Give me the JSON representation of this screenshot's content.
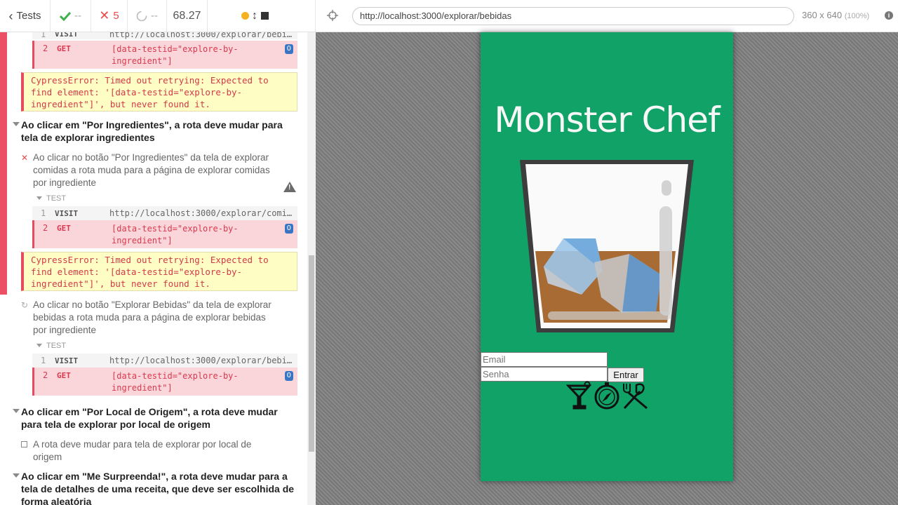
{
  "reporter": {
    "stats": {
      "tests_label": "Tests",
      "passed": "--",
      "failed": "5",
      "pending": "--",
      "duration": "68.27"
    },
    "commands_top": [
      {
        "num": "1",
        "name": "VISIT",
        "msg": "http://localhost:3000/explorar/bebi..."
      },
      {
        "num": "2",
        "name": "GET",
        "msg": "[data-testid=\"explore-by-ingredient\"]",
        "badge": "0"
      }
    ],
    "error_1": "CypressError: Timed out retrying: Expected to find element: '[data-testid=\"explore-by-ingredient\"]', but never found it.",
    "suite_1": "Ao clicar em \"Por Ingredientes\", a rota deve mudar para tela de explorar ingredientes",
    "test_1": "Ao clicar no botão \"Por Ingredientes\" da tela de explorar comidas a rota muda para a página de explorar comidas por ingrediente",
    "test_label": "TEST",
    "commands_1": [
      {
        "num": "1",
        "name": "VISIT",
        "msg": "http://localhost:3000/explorar/comi..."
      },
      {
        "num": "2",
        "name": "GET",
        "msg": "[data-testid=\"explore-by-ingredient\"]",
        "badge": "0"
      }
    ],
    "error_2": "CypressError: Timed out retrying: Expected to find element: '[data-testid=\"explore-by-ingredient\"]', but never found it.",
    "test_2": "Ao clicar no botão \"Explorar Bebidas\" da tela de explorar bebidas a rota muda para a página de explorar bebidas por ingrediente",
    "commands_2": [
      {
        "num": "1",
        "name": "VISIT",
        "msg": "http://localhost:3000/explorar/bebi..."
      },
      {
        "num": "2",
        "name": "GET",
        "msg": "[data-testid=\"explore-by-ingredient\"]",
        "badge": "0"
      }
    ],
    "suite_2": "Ao clicar em \"Por Local de Origem\", a rota deve mudar para tela de explorar por local de origem",
    "test_3": "A rota deve mudar para tela de explorar por local de origem",
    "suite_3": "Ao clicar em \"Me Surpreenda!\", a rota deve mudar para a tela de detalhes de uma receita, que deve ser escolhida de forma aleatória"
  },
  "browser": {
    "url": "http://localhost:3000/explorar/bebidas",
    "viewport": "360 x 640",
    "zoom": "(100%)"
  },
  "app": {
    "title": "Monster Chef",
    "email_placeholder": "Email",
    "senha_placeholder": "Senha",
    "entrar_label": "Entrar",
    "background_color": "#10a266"
  }
}
